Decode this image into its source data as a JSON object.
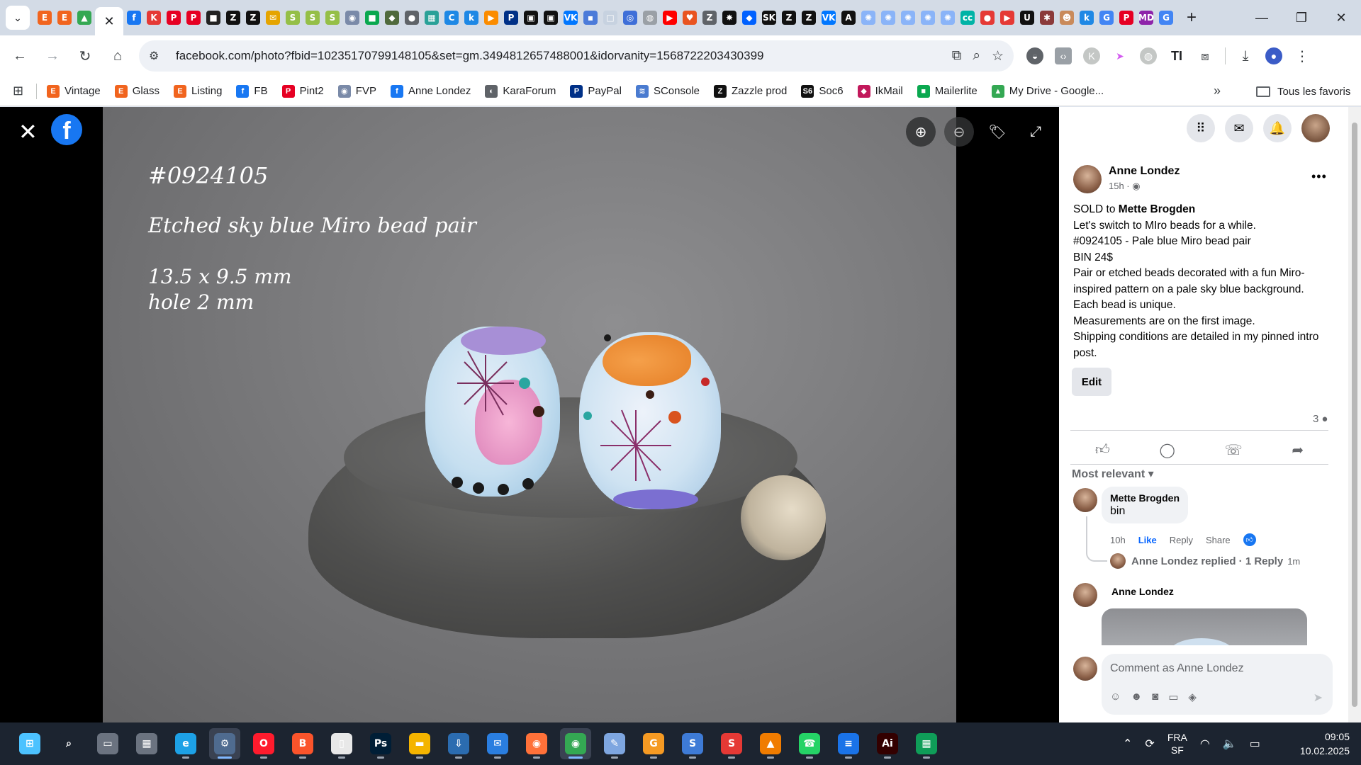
{
  "browser": {
    "tabs": [
      {
        "icon": "etsy-icon",
        "glyph": "E",
        "color": "#f1641e"
      },
      {
        "icon": "etsy-icon",
        "glyph": "E",
        "color": "#f1641e"
      },
      {
        "icon": "drive-icon",
        "glyph": "▲",
        "color": "#34a853"
      },
      {
        "icon": "close-icon",
        "glyph": "✕",
        "color": "#202124",
        "active": true
      },
      {
        "icon": "facebook-icon",
        "glyph": "f",
        "color": "#1877f2"
      },
      {
        "icon": "kajabi-icon",
        "glyph": "K",
        "color": "#e53935"
      },
      {
        "icon": "pinterest-icon",
        "glyph": "P",
        "color": "#e60023"
      },
      {
        "icon": "pinterest-icon",
        "glyph": "P",
        "color": "#e60023"
      },
      {
        "icon": "app-icon",
        "glyph": "■",
        "color": "#222222"
      },
      {
        "icon": "zazzle-icon",
        "glyph": "Z",
        "color": "#111111"
      },
      {
        "icon": "zazzle-icon",
        "glyph": "Z",
        "color": "#111111"
      },
      {
        "icon": "app-icon",
        "glyph": "✉",
        "color": "#e5a400"
      },
      {
        "icon": "shopify-icon",
        "glyph": "S",
        "color": "#95bf47"
      },
      {
        "icon": "shopify-icon",
        "glyph": "S",
        "color": "#95bf47"
      },
      {
        "icon": "shopify-icon",
        "glyph": "S",
        "color": "#95bf47"
      },
      {
        "icon": "app-icon",
        "glyph": "◉",
        "color": "#7a8aa8"
      },
      {
        "icon": "chat-icon",
        "glyph": "■",
        "color": "#0aa84f"
      },
      {
        "icon": "turtle-icon",
        "glyph": "◆",
        "color": "#506a3c"
      },
      {
        "icon": "app-icon",
        "glyph": "●",
        "color": "#5f6368"
      },
      {
        "icon": "app-icon",
        "glyph": "▦",
        "color": "#2aa198"
      },
      {
        "icon": "app-icon",
        "glyph": "C",
        "color": "#1e88e5"
      },
      {
        "icon": "app-icon",
        "glyph": "k",
        "color": "#1e88e5"
      },
      {
        "icon": "app-icon",
        "glyph": "▶",
        "color": "#fb8c00"
      },
      {
        "icon": "paypal-icon",
        "glyph": "P",
        "color": "#003087"
      },
      {
        "icon": "app-icon",
        "glyph": "▣",
        "color": "#111111"
      },
      {
        "icon": "app-icon",
        "glyph": "▣",
        "color": "#111111"
      },
      {
        "icon": "vk-icon",
        "glyph": "VK",
        "color": "#0077ff"
      },
      {
        "icon": "app-icon",
        "glyph": "▪",
        "color": "#4c7bd9"
      },
      {
        "icon": "app-icon",
        "glyph": "□",
        "color": "#c7d2e0"
      },
      {
        "icon": "app-icon",
        "glyph": "◎",
        "color": "#3f6fd8"
      },
      {
        "icon": "app-icon",
        "glyph": "◍",
        "color": "#9aa0a6"
      },
      {
        "icon": "youtube-icon",
        "glyph": "▶",
        "color": "#ff0000"
      },
      {
        "icon": "heart-icon",
        "glyph": "♥",
        "color": "#e95420"
      },
      {
        "icon": "app-icon",
        "glyph": "Z",
        "color": "#5f6368"
      },
      {
        "icon": "app-icon",
        "glyph": "✸",
        "color": "#111111"
      },
      {
        "icon": "dropbox-icon",
        "glyph": "◆",
        "color": "#0061ff"
      },
      {
        "icon": "app-icon",
        "glyph": "SK",
        "color": "#111111"
      },
      {
        "icon": "zazzle-icon",
        "glyph": "Z",
        "color": "#111111"
      },
      {
        "icon": "zazzle-icon",
        "glyph": "Z",
        "color": "#111111"
      },
      {
        "icon": "vk-icon",
        "glyph": "VK",
        "color": "#0077ff"
      },
      {
        "icon": "app-icon",
        "glyph": "A",
        "color": "#111111"
      },
      {
        "icon": "gear-icon",
        "glyph": "✺",
        "color": "#8ab4f8"
      },
      {
        "icon": "gear-icon",
        "glyph": "✺",
        "color": "#8ab4f8"
      },
      {
        "icon": "gear-icon",
        "glyph": "✺",
        "color": "#8ab4f8"
      },
      {
        "icon": "gear-icon",
        "glyph": "✺",
        "color": "#8ab4f8"
      },
      {
        "icon": "gear-icon",
        "glyph": "✺",
        "color": "#8ab4f8"
      },
      {
        "icon": "app-icon",
        "glyph": "cc",
        "color": "#00b3a6"
      },
      {
        "icon": "app-icon",
        "glyph": "●",
        "color": "#e53935"
      },
      {
        "icon": "app-icon",
        "glyph": "▶",
        "color": "#e53935"
      },
      {
        "icon": "app-icon",
        "glyph": "U",
        "color": "#111111"
      },
      {
        "icon": "app-icon",
        "glyph": "✱",
        "color": "#8b3a3a"
      },
      {
        "icon": "app-icon",
        "glyph": "☻",
        "color": "#c98a5a"
      },
      {
        "icon": "app-icon",
        "glyph": "k",
        "color": "#1e88e5"
      },
      {
        "icon": "google-icon",
        "glyph": "G",
        "color": "#4285f4"
      },
      {
        "icon": "pinterest-icon",
        "glyph": "P",
        "color": "#e60023"
      },
      {
        "icon": "app-icon",
        "glyph": "MD",
        "color": "#8e24aa"
      },
      {
        "icon": "google-icon",
        "glyph": "G",
        "color": "#4285f4"
      }
    ],
    "new_tab_label": "+",
    "url": "facebook.com/photo?fbid=10235170799148105&set=gm.3494812657488001&idorvanity=1568722203430399",
    "bookmarks": [
      {
        "label": "Vintage",
        "icon": "etsy-icon",
        "glyph": "E",
        "color": "#f1641e"
      },
      {
        "label": "Glass",
        "icon": "etsy-icon",
        "glyph": "E",
        "color": "#f1641e"
      },
      {
        "label": "Listing",
        "icon": "etsy-icon",
        "glyph": "E",
        "color": "#f1641e"
      },
      {
        "label": "FB",
        "icon": "facebook-icon",
        "glyph": "f",
        "color": "#1877f2"
      },
      {
        "label": "Pint2",
        "icon": "pinterest-icon",
        "glyph": "P",
        "color": "#e60023"
      },
      {
        "label": "FVP",
        "icon": "app-icon",
        "glyph": "◉",
        "color": "#7a8aa8"
      },
      {
        "label": "Anne Londez",
        "icon": "facebook-icon",
        "glyph": "f",
        "color": "#1877f2"
      },
      {
        "label": "KaraForum",
        "icon": "globe-icon",
        "glyph": "◐",
        "color": "#5f6368"
      },
      {
        "label": "PayPal",
        "icon": "paypal-icon",
        "glyph": "P",
        "color": "#003087"
      },
      {
        "label": "SConsole",
        "icon": "app-icon",
        "glyph": "≋",
        "color": "#4a7bd0"
      },
      {
        "label": "Zazzle prod",
        "icon": "zazzle-icon",
        "glyph": "Z",
        "color": "#111111"
      },
      {
        "label": "Soc6",
        "icon": "app-icon",
        "glyph": "S6",
        "color": "#111111"
      },
      {
        "label": "IkMail",
        "icon": "app-icon",
        "glyph": "◆",
        "color": "#c2185b"
      },
      {
        "label": "Mailerlite",
        "icon": "chat-icon",
        "glyph": "■",
        "color": "#0aa84f"
      },
      {
        "label": "My Drive - Google...",
        "icon": "drive-icon",
        "glyph": "▲",
        "color": "#34a853"
      }
    ],
    "all_bookmarks": "Tous les favoris"
  },
  "photo": {
    "code": "#0924105",
    "title": "Etched sky blue Miro bead pair",
    "size_line": "13.5 x 9.5 mm",
    "hole_line": "hole 2 mm"
  },
  "post": {
    "author": "Anne Londez",
    "time": "15h ·",
    "sold_prefix": "SOLD to ",
    "sold_to": "Mette Brogden",
    "lines": [
      "Let's switch to MIro beads for a while.",
      "#0924105 - Pale blue Miro bead pair",
      "BIN 24$",
      "Pair or etched beads decorated with a fun Miro-inspired pattern on a pale sky blue background.",
      "Each bead is unique.",
      "Measurements are on the first image.",
      "Shipping conditions are detailed in my pinned intro post."
    ],
    "edit_label": "Edit",
    "comment_count": "3",
    "sort_label": "Most relevant"
  },
  "comments": {
    "c1_author": "Mette Brogden",
    "c1_text": "bin",
    "c1_time": "10h",
    "like_label": "Like",
    "reply_label": "Reply",
    "share_label": "Share",
    "reply_summary_author": "Anne Londez replied · 1 Reply",
    "reply_summary_time": "1m",
    "c2_author": "Anne Londez",
    "composer_placeholder": "Comment as Anne Londez"
  },
  "taskbar": {
    "apps": [
      {
        "icon": "windows-start-icon",
        "glyph": "⊞",
        "color": "#4cc2ff"
      },
      {
        "icon": "search-icon",
        "glyph": "⌕",
        "color": "#1c2430"
      },
      {
        "icon": "task-view-icon",
        "glyph": "▭",
        "color": "#6b7380"
      },
      {
        "icon": "calculator-icon",
        "glyph": "▦",
        "color": "#6b7380"
      },
      {
        "icon": "edge-icon",
        "glyph": "e",
        "color": "#1da1e6"
      },
      {
        "icon": "settings-icon",
        "glyph": "⚙",
        "color": "#4f6b8f",
        "active": true
      },
      {
        "icon": "opera-icon",
        "glyph": "O",
        "color": "#ff1b2d"
      },
      {
        "icon": "brave-icon",
        "glyph": "B",
        "color": "#fb542b"
      },
      {
        "icon": "file-icon",
        "glyph": "▯",
        "color": "#e8e8e8"
      },
      {
        "icon": "photoshop-icon",
        "glyph": "Ps",
        "color": "#001e36"
      },
      {
        "icon": "folder-icon",
        "glyph": "▬",
        "color": "#f4b400"
      },
      {
        "icon": "installer-icon",
        "glyph": "⇩",
        "color": "#2b6cb0"
      },
      {
        "icon": "thunderbird-icon",
        "glyph": "✉",
        "color": "#2a7ee0"
      },
      {
        "icon": "firefox-icon",
        "glyph": "◉",
        "color": "#ff7139"
      },
      {
        "icon": "chrome-icon",
        "glyph": "◉",
        "color": "#34a853",
        "active": true
      },
      {
        "icon": "feather-icon",
        "glyph": "✎",
        "color": "#7ea6e0"
      },
      {
        "icon": "pdf-icon",
        "glyph": "G",
        "color": "#f59a23"
      },
      {
        "icon": "app-s-icon",
        "glyph": "S",
        "color": "#3e7bd6"
      },
      {
        "icon": "app-s-icon",
        "glyph": "S",
        "color": "#e53935"
      },
      {
        "icon": "vlc-icon",
        "glyph": "▲",
        "color": "#f07c00"
      },
      {
        "icon": "whatsapp-icon",
        "glyph": "☎",
        "color": "#25d366"
      },
      {
        "icon": "docs-icon",
        "glyph": "≡",
        "color": "#1a73e8"
      },
      {
        "icon": "illustrator-icon",
        "glyph": "Ai",
        "color": "#330000"
      },
      {
        "icon": "sheets-icon",
        "glyph": "▦",
        "color": "#0f9d58"
      }
    ],
    "lang_top": "FRA",
    "lang_bottom": "SF",
    "time": "09:05",
    "date": "10.02.2025"
  }
}
